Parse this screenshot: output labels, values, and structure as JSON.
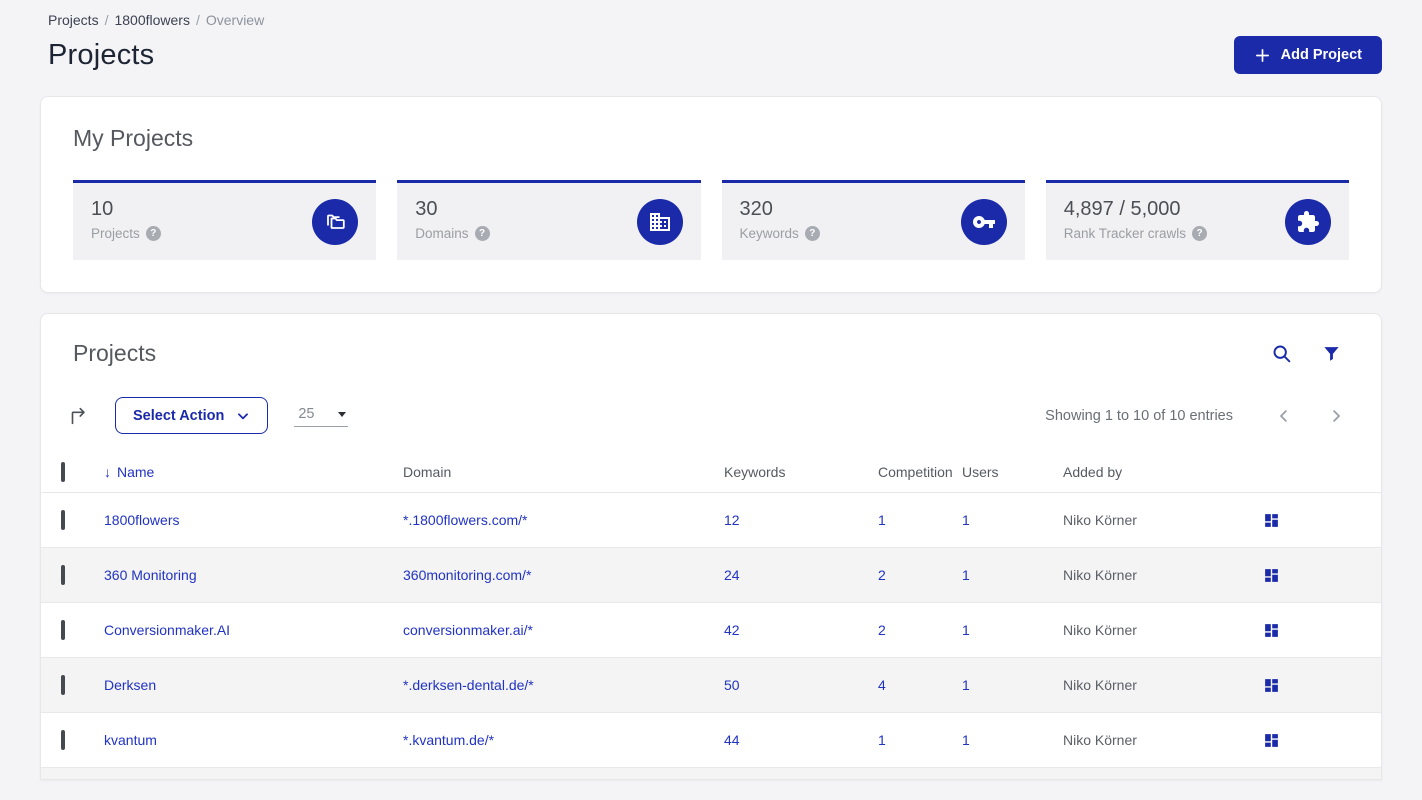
{
  "colors": {
    "brand_blue": "#1b2aa9",
    "link_blue": "#2133c2",
    "page_bg": "#f4f4f6",
    "stripe_bg": "#f4f4f5",
    "heading_gray": "#55585e"
  },
  "breadcrumb": {
    "separator": "/",
    "items": [
      {
        "label": "Projects"
      },
      {
        "label": "1800flowers"
      },
      {
        "label": "Overview"
      }
    ]
  },
  "page": {
    "title": "Projects"
  },
  "header": {
    "add_project_label": "Add Project"
  },
  "my_projects": {
    "title": "My Projects",
    "help_glyph": "?",
    "stats": [
      {
        "value": "10",
        "label": "Projects",
        "icon": "folders-icon"
      },
      {
        "value": "30",
        "label": "Domains",
        "icon": "building-icon"
      },
      {
        "value": "320",
        "label": "Keywords",
        "icon": "key-icon"
      },
      {
        "value": "4,897 / 5,000",
        "label": "Rank Tracker crawls",
        "icon": "puzzle-icon"
      }
    ]
  },
  "projects_panel": {
    "title": "Projects",
    "toolbar": {
      "select_action_label": "Select Action",
      "page_size_value": "25",
      "showing_text": "Showing 1 to 10 of 10 entries"
    },
    "table": {
      "sort_arrow": "↓",
      "columns": {
        "name": "Name",
        "domain": "Domain",
        "keywords": "Keywords",
        "competition": "Competition",
        "users": "Users",
        "added_by": "Added by"
      },
      "rows": [
        {
          "name": "1800flowers",
          "domain": "*.1800flowers.com/*",
          "keywords": "12",
          "competition": "1",
          "users": "1",
          "added_by": "Niko Körner"
        },
        {
          "name": "360 Monitoring",
          "domain": "360monitoring.com/*",
          "keywords": "24",
          "competition": "2",
          "users": "1",
          "added_by": "Niko Körner"
        },
        {
          "name": "Conversionmaker.AI",
          "domain": "conversionmaker.ai/*",
          "keywords": "42",
          "competition": "2",
          "users": "1",
          "added_by": "Niko Körner"
        },
        {
          "name": "Derksen",
          "domain": "*.derksen-dental.de/*",
          "keywords": "50",
          "competition": "4",
          "users": "1",
          "added_by": "Niko Körner"
        },
        {
          "name": "kvantum",
          "domain": "*.kvantum.de/*",
          "keywords": "44",
          "competition": "1",
          "users": "1",
          "added_by": "Niko Körner"
        }
      ]
    }
  }
}
